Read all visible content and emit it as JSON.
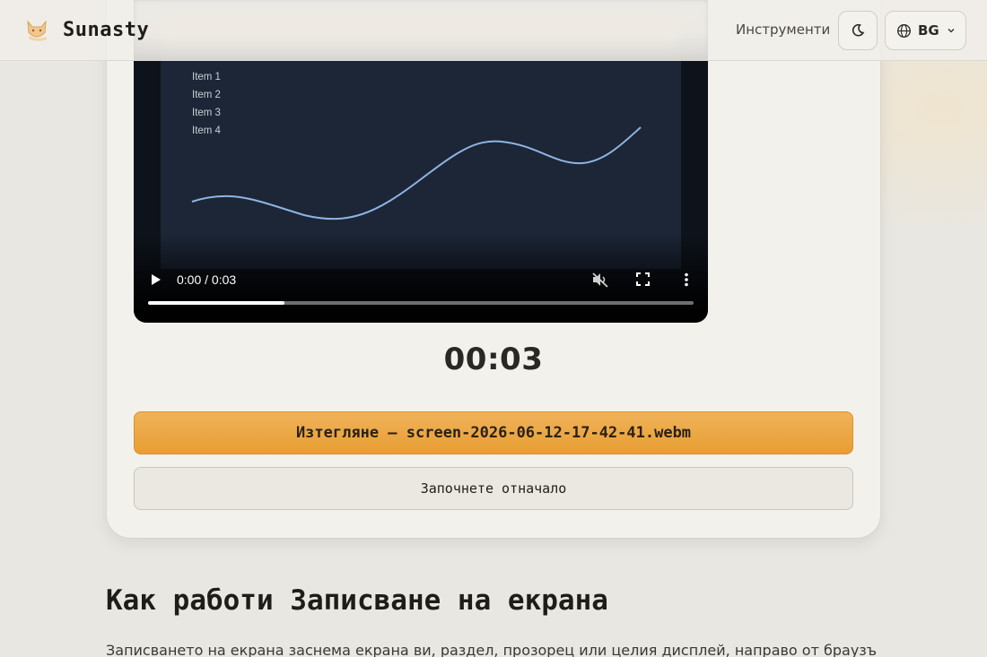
{
  "header": {
    "brand": "Sunasty",
    "nav_tools": "Инструменти",
    "lang": "BG"
  },
  "video": {
    "legend": [
      "Item 1",
      "Item 2",
      "Item 3",
      "Item 4"
    ],
    "time": "0:00 / 0:03",
    "progress": 0.25
  },
  "timer": "00:03",
  "download_label": "Изтегляне — screen-2026-06-12-17-42-41.webm",
  "restart_label": "Започнете отначало",
  "section": {
    "title": "Как работи Записване на екрана",
    "text": "Записването на екрана заснема екрана ви, раздел, прозорец или целия дисплей, направо от браузъра и"
  },
  "colors": {
    "accent": "#e89e32",
    "line": "#8fb4e3"
  }
}
